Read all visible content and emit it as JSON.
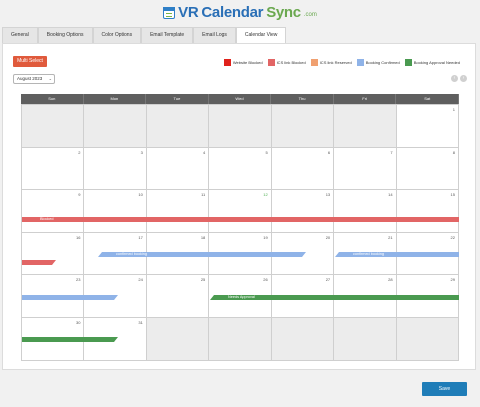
{
  "logo": {
    "vr": "VR",
    "calendar": "Calendar",
    "sync": "Sync",
    "com": ".com"
  },
  "tabs": [
    {
      "label": "General"
    },
    {
      "label": "Booking Options"
    },
    {
      "label": "Color Options"
    },
    {
      "label": "Email Template"
    },
    {
      "label": "Email Logs"
    },
    {
      "label": "Calendar View"
    }
  ],
  "active_tab": "Calendar View",
  "multi_select_label": "Multi Select",
  "legend": [
    {
      "label": "Website Blocked",
      "color": "#e0221b"
    },
    {
      "label": "ICS link Blocked",
      "color": "#e26565"
    },
    {
      "label": "ICS link Reserved",
      "color": "#f0a070"
    },
    {
      "label": "Booking Confirmed",
      "color": "#8fb3e8"
    },
    {
      "label": "Booking Approval Needed",
      "color": "#4a9a50"
    }
  ],
  "month_select": {
    "value": "August 2023",
    "chevron": "⌄"
  },
  "nav": {
    "prev": "‹",
    "next": "›"
  },
  "weekdays": [
    "Sun",
    "Mon",
    "Tue",
    "Wed",
    "Thu",
    "Fri",
    "Sat"
  ],
  "weeks": [
    [
      {
        "d": "",
        "o": true
      },
      {
        "d": "",
        "o": true
      },
      {
        "d": "",
        "o": true
      },
      {
        "d": "",
        "o": true
      },
      {
        "d": "",
        "o": true
      },
      {
        "d": "",
        "o": true
      },
      {
        "d": "1"
      }
    ],
    [
      {
        "d": "2"
      },
      {
        "d": "3"
      },
      {
        "d": "4"
      },
      {
        "d": "5"
      },
      {
        "d": "6"
      },
      {
        "d": "7"
      },
      {
        "d": "8"
      }
    ],
    [
      {
        "d": "9"
      },
      {
        "d": "10"
      },
      {
        "d": "11"
      },
      {
        "d": "12",
        "g": true
      },
      {
        "d": "13"
      },
      {
        "d": "14"
      },
      {
        "d": "15"
      }
    ],
    [
      {
        "d": "16"
      },
      {
        "d": "17"
      },
      {
        "d": "18"
      },
      {
        "d": "19"
      },
      {
        "d": "20"
      },
      {
        "d": "21"
      },
      {
        "d": "22"
      }
    ],
    [
      {
        "d": "23"
      },
      {
        "d": "24"
      },
      {
        "d": "25"
      },
      {
        "d": "26"
      },
      {
        "d": "27"
      },
      {
        "d": "28"
      },
      {
        "d": "29"
      }
    ],
    [
      {
        "d": "30"
      },
      {
        "d": "31"
      },
      {
        "d": "",
        "o": true
      },
      {
        "d": "",
        "o": true
      },
      {
        "d": "",
        "o": true
      },
      {
        "d": "",
        "o": true
      },
      {
        "d": "",
        "o": true
      }
    ]
  ],
  "bookings": [
    {
      "label": "Blocked",
      "color": "red"
    },
    {
      "label": "",
      "color": "red"
    },
    {
      "label": "confirmed booking",
      "color": "blue"
    },
    {
      "label": "confirmed booking",
      "color": "blue"
    },
    {
      "label": "",
      "color": "blue"
    },
    {
      "label": "Needs Approval",
      "color": "green"
    },
    {
      "label": "",
      "color": "green"
    }
  ],
  "save_label": "Save"
}
